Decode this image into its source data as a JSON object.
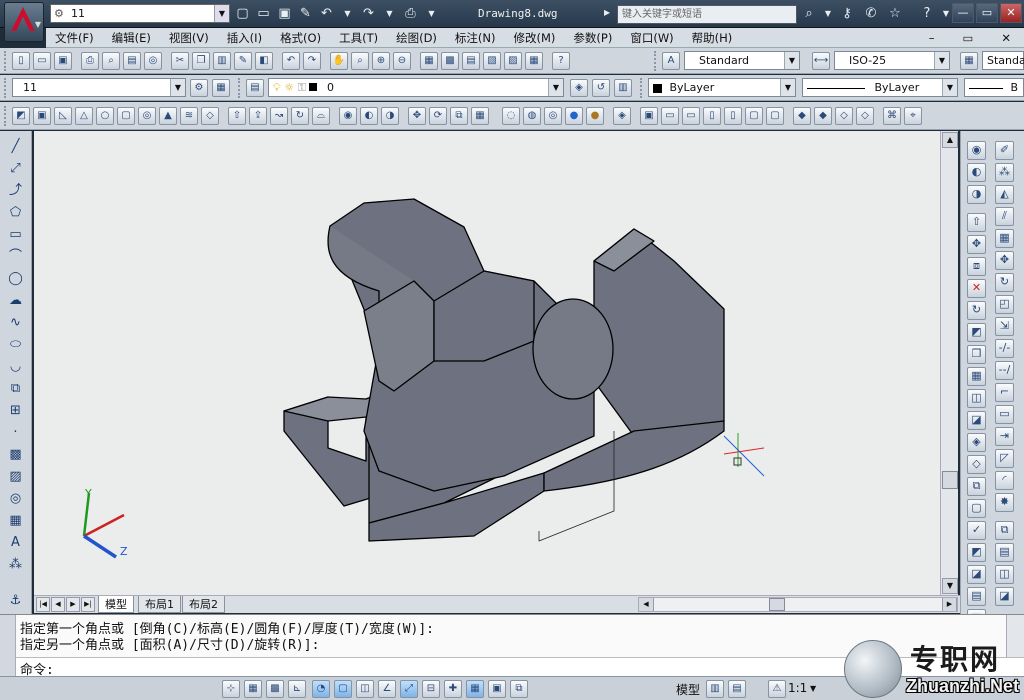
{
  "title_bar": {
    "workspace": "11",
    "document_title": "Drawing8.dwg",
    "search_placeholder": "键入关键字或短语",
    "window_controls": [
      "—",
      "▭",
      "✕"
    ]
  },
  "menu": {
    "items": [
      "文件(F)",
      "编辑(E)",
      "视图(V)",
      "插入(I)",
      "格式(O)",
      "工具(T)",
      "绘图(D)",
      "标注(N)",
      "修改(M)",
      "参数(P)",
      "窗口(W)",
      "帮助(H)"
    ]
  },
  "styles_toolbar": {
    "text_style": "Standard",
    "dim_style": "ISO-25",
    "table_style": "Standa"
  },
  "layers_toolbar": {
    "workspace_combo": "11",
    "layer_name": "0",
    "color": "ByLayer",
    "linetype": "ByLayer",
    "lineweight": "B"
  },
  "layout_tabs": [
    "模型",
    "布局1",
    "布局2"
  ],
  "command_line": {
    "history": [
      "指定第一个角点或 [倒角(C)/标高(E)/圆角(F)/厚度(T)/宽度(W)]:",
      "指定另一个角点或 [面积(A)/尺寸(D)/旋转(R)]:"
    ],
    "prompt": "命令:"
  },
  "status_bar": {
    "model_label": "模型",
    "scale": "1:1"
  },
  "watermark": {
    "chinese": "专职网",
    "english": "Zhuanzhi.Net"
  },
  "colors": {
    "model_fill": "#6e7280",
    "model_top": "#8b8f9a",
    "canvas_bg": "#ebecec",
    "axis_x": "#d42020",
    "axis_y": "#20a020",
    "axis_z": "#2060d0"
  }
}
